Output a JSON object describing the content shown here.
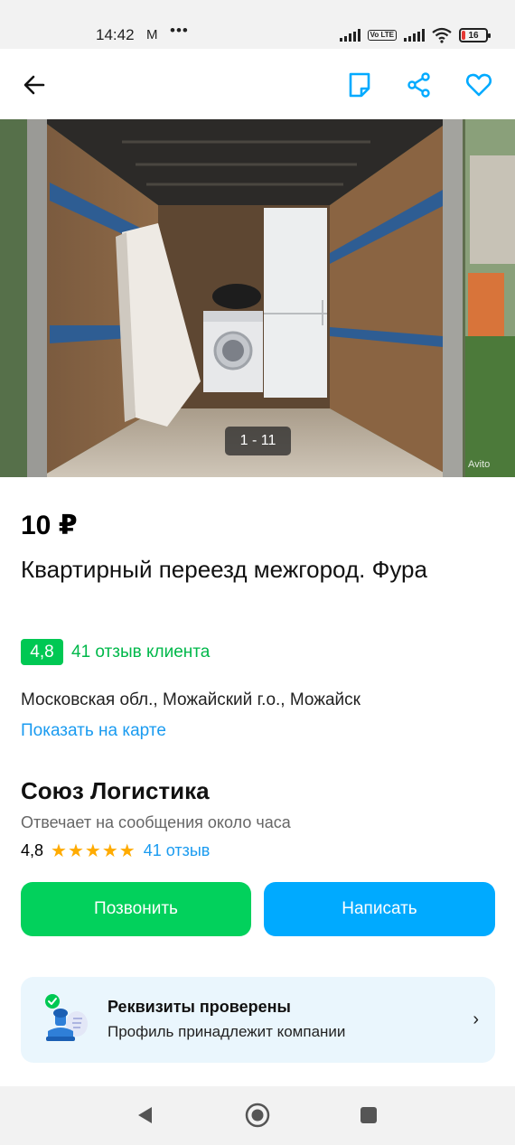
{
  "status_bar": {
    "time": "14:42",
    "mail_icon": "M",
    "more": "•••",
    "lte_label": "Vo LTE",
    "battery": "16"
  },
  "toolbar": {
    "back_icon": "arrow-left-icon",
    "note_icon": "note-icon",
    "share_icon": "share-icon",
    "favorite_icon": "heart-icon",
    "accent_color": "#00aaff"
  },
  "gallery": {
    "counter": "1 - 11",
    "watermark": "Avito"
  },
  "listing": {
    "price": "10 ₽",
    "title": "Квартирный переезд межгород. Фура",
    "rating": "4,8",
    "reviews": "41 отзыв клиента",
    "address": "Московская обл., Можайский г.о., Можайск",
    "map_link": "Показать на карте"
  },
  "seller": {
    "name": "Союз Логистика",
    "response": "Отвечает на сообщения около часа",
    "rating": "4,8",
    "stars": "★★★★★",
    "reviews": "41 отзыв"
  },
  "actions": {
    "call": "Позвонить",
    "message": "Написать",
    "call_color": "#02d15c",
    "message_color": "#00aaff"
  },
  "verified": {
    "title": "Реквизиты проверены",
    "subtitle": "Профиль принадлежит компании",
    "chevron": "›",
    "icon": "stamp-check-icon"
  },
  "nav": {
    "back_icon": "nav-back-icon",
    "home_icon": "nav-home-icon",
    "recents_icon": "nav-recents-icon"
  }
}
